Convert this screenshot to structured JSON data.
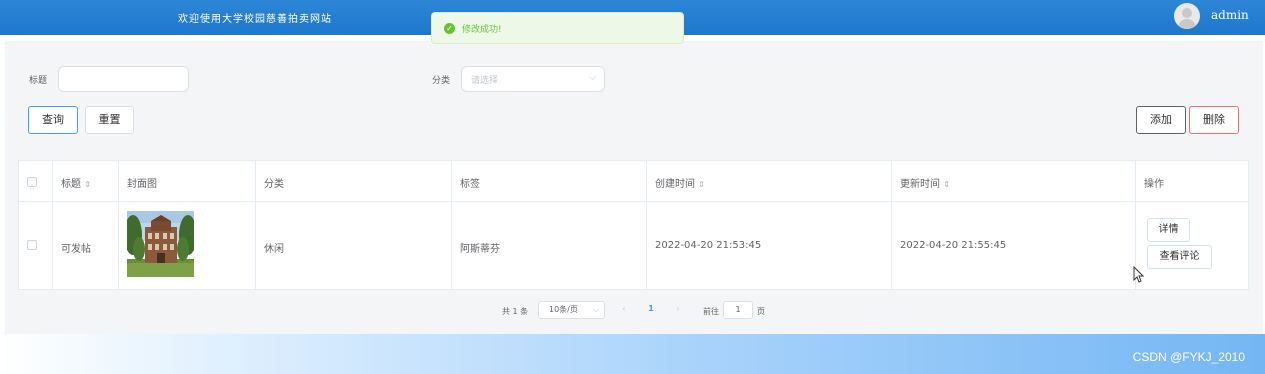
{
  "header": {
    "site_title": "欢迎使用大学校园慈善拍卖网站",
    "user_name": "admin",
    "avatar_icon": "user-avatar-icon",
    "bg_color": "#1f77cc"
  },
  "toast": {
    "message": "修改成功!",
    "icon": "check-circle-icon",
    "color": "#67c23a"
  },
  "search": {
    "title_label": "标题",
    "title_value": "",
    "category_label": "分类",
    "category_placeholder": "请选择",
    "query_label": "查询",
    "reset_label": "重置"
  },
  "actions": {
    "add_label": "添加",
    "delete_label": "删除",
    "delete_color": "#f56c6c"
  },
  "table": {
    "columns": [
      "标题",
      "封面图",
      "分类",
      "标签",
      "创建时间",
      "更新时间",
      "操作"
    ],
    "rows": [
      {
        "title": "可发帖",
        "cover": "campus-building-image",
        "category": "休闲",
        "tag": "阿斯蒂芬",
        "created": "2022-04-20 21:53:45",
        "updated": "2022-04-20 21:55:45",
        "detail_label": "详情",
        "comments_label": "查看评论"
      }
    ]
  },
  "pagination": {
    "total_text": "共 1 条",
    "page_size": "10条/页",
    "current_page": "1",
    "goto_label": "前往",
    "goto_value": "1",
    "page_unit": "页",
    "prev_icon": "chevron-left-icon",
    "next_icon": "chevron-right-icon"
  },
  "watermark": "CSDN @FYKJ_2010"
}
